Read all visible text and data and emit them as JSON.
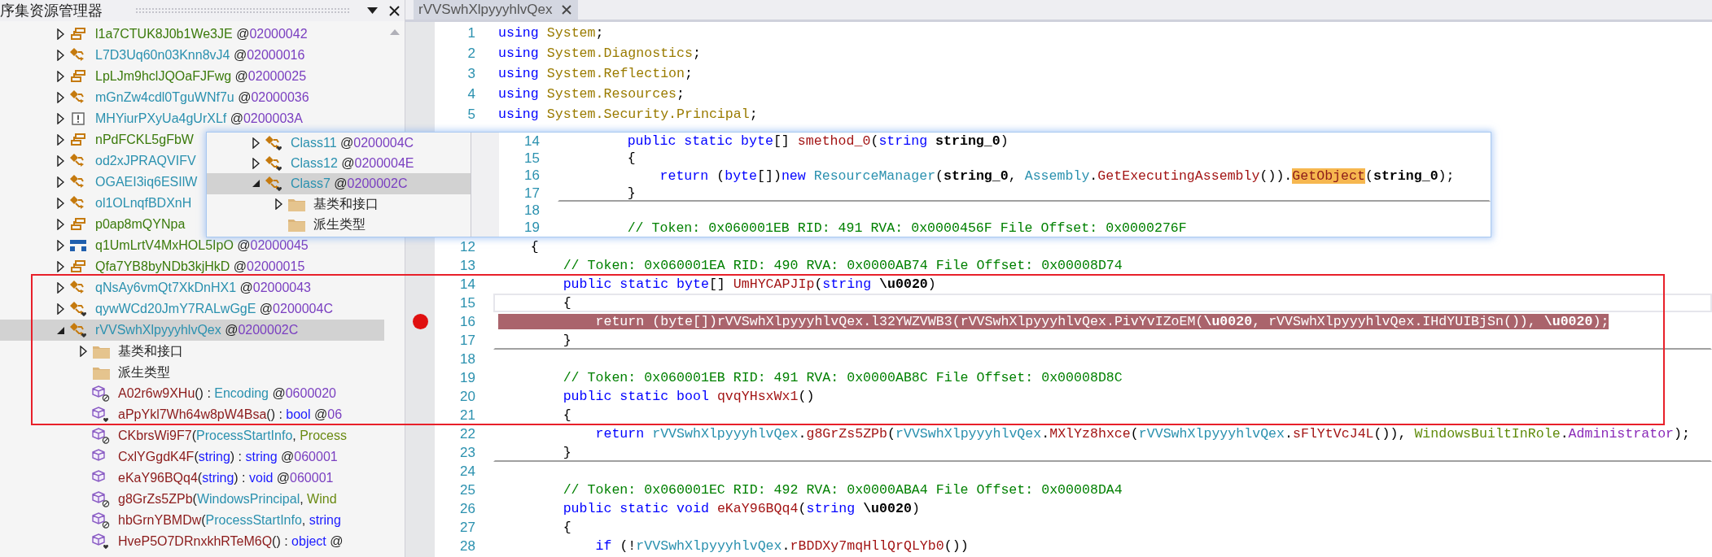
{
  "explorer": {
    "title": "序集资源管理器",
    "nodes": [
      {
        "kind": "static-class",
        "expanded": false,
        "selected": false,
        "parts": [
          {
            "text": "l1a7CTUK8J0b1We3JE",
            "kind": "sname"
          },
          {
            "text": " @",
            "kind": "punct"
          },
          {
            "text": "02000042",
            "kind": "token"
          }
        ]
      },
      {
        "kind": "class",
        "expanded": false,
        "selected": false,
        "parts": [
          {
            "text": "L7D3Uq60n03Knn8vJ4",
            "kind": "cname"
          },
          {
            "text": " @",
            "kind": "punct"
          },
          {
            "text": "02000016",
            "kind": "token"
          }
        ]
      },
      {
        "kind": "static-class",
        "expanded": false,
        "selected": false,
        "parts": [
          {
            "text": "LpLJm9hclJQOaFJFwg",
            "kind": "sname"
          },
          {
            "text": " @",
            "kind": "punct"
          },
          {
            "text": "02000025",
            "kind": "token"
          }
        ]
      },
      {
        "kind": "class",
        "expanded": false,
        "selected": false,
        "parts": [
          {
            "text": "mGnZw4cdl0TguWNf7u",
            "kind": "cname"
          },
          {
            "text": " @",
            "kind": "punct"
          },
          {
            "text": "02000036",
            "kind": "token"
          }
        ]
      },
      {
        "kind": "exception",
        "expanded": false,
        "selected": false,
        "parts": [
          {
            "text": "MHYiurPXyUa4gUrXLf",
            "kind": "cname"
          },
          {
            "text": " @",
            "kind": "punct"
          },
          {
            "text": "0200003A",
            "kind": "token"
          }
        ]
      },
      {
        "kind": "static-class",
        "expanded": false,
        "selected": false,
        "parts": [
          {
            "text": "nPdFCKL5gFbW",
            "kind": "sname"
          }
        ]
      },
      {
        "kind": "class",
        "expanded": false,
        "selected": false,
        "parts": [
          {
            "text": "od2xJPRAQVIFV",
            "kind": "cname"
          }
        ]
      },
      {
        "kind": "class",
        "expanded": false,
        "selected": false,
        "parts": [
          {
            "text": "OGAEI3iq6ESIlW",
            "kind": "cname"
          }
        ]
      },
      {
        "kind": "class",
        "expanded": false,
        "selected": false,
        "parts": [
          {
            "text": "ol1OLnqfBDXnH",
            "kind": "cname"
          }
        ]
      },
      {
        "kind": "static-class",
        "expanded": false,
        "selected": false,
        "parts": [
          {
            "text": "p0ap8mQYNpa",
            "kind": "sname"
          }
        ]
      },
      {
        "kind": "struct",
        "expanded": false,
        "selected": false,
        "parts": [
          {
            "text": "q1UmLrtV4MxHOL5IpO",
            "kind": "sname"
          },
          {
            "text": " @",
            "kind": "punct"
          },
          {
            "text": "02000045",
            "kind": "token"
          }
        ]
      },
      {
        "kind": "static-class",
        "expanded": false,
        "selected": false,
        "parts": [
          {
            "text": "Qfa7YB8byNDb3kjHkD",
            "kind": "sname"
          },
          {
            "text": " @",
            "kind": "punct"
          },
          {
            "text": "02000015",
            "kind": "token"
          }
        ]
      },
      {
        "kind": "class",
        "expanded": false,
        "selected": false,
        "parts": [
          {
            "text": "qNsAy6vmQt7XkDnHX1",
            "kind": "cname"
          },
          {
            "text": " @",
            "kind": "punct"
          },
          {
            "text": "02000043",
            "kind": "token"
          }
        ]
      },
      {
        "kind": "internal-class",
        "expanded": false,
        "selected": false,
        "parts": [
          {
            "text": "qywWCd20JmY7RALwGgE",
            "kind": "cname"
          },
          {
            "text": " @",
            "kind": "punct"
          },
          {
            "text": "0200004C",
            "kind": "token"
          }
        ]
      },
      {
        "kind": "internal-class",
        "expanded": true,
        "selected": true,
        "parts": [
          {
            "text": "rVVSwhXlpyyyhlvQex",
            "kind": "cname"
          },
          {
            "text": " @",
            "kind": "punct"
          },
          {
            "text": "0200002C",
            "kind": "token"
          }
        ],
        "children": [
          {
            "kind": "folder",
            "expanded": false,
            "selected": false,
            "parts": [
              {
                "text": "基类和接口",
                "kind": "text"
              }
            ]
          },
          {
            "kind": "folder",
            "selected": false,
            "parts": [
              {
                "text": "派生类型",
                "kind": "text"
              }
            ]
          },
          {
            "kind": "private-method",
            "selected": false,
            "parts": [
              {
                "text": "A02r6w9XHu",
                "kind": "mname"
              },
              {
                "text": "() : ",
                "kind": "punct"
              },
              {
                "text": "Encoding",
                "kind": "type"
              },
              {
                "text": " @",
                "kind": "punct"
              },
              {
                "text": "0600020",
                "kind": "token"
              }
            ]
          },
          {
            "kind": "internal-method",
            "selected": false,
            "parts": [
              {
                "text": "aPpYkl7Wh64w8pW4Bsa",
                "kind": "mname"
              },
              {
                "text": "() : ",
                "kind": "punct"
              },
              {
                "text": "bool",
                "kind": "kw"
              },
              {
                "text": " @",
                "kind": "punct"
              },
              {
                "text": "06",
                "kind": "token"
              }
            ]
          },
          {
            "kind": "private-method",
            "selected": false,
            "parts": [
              {
                "text": "CKbrsWi9F7",
                "kind": "mname"
              },
              {
                "text": "(",
                "kind": "punct"
              },
              {
                "text": "ProcessStartInfo",
                "kind": "type"
              },
              {
                "text": ", ",
                "kind": "punct"
              },
              {
                "text": "Process",
                "kind": "enum"
              }
            ]
          },
          {
            "kind": "method",
            "selected": false,
            "parts": [
              {
                "text": "CxlYGgdK4F",
                "kind": "mname"
              },
              {
                "text": "(",
                "kind": "punct"
              },
              {
                "text": "string",
                "kind": "kw"
              },
              {
                "text": ") : ",
                "kind": "punct"
              },
              {
                "text": "string",
                "kind": "kw"
              },
              {
                "text": " @",
                "kind": "punct"
              },
              {
                "text": "060001",
                "kind": "token"
              }
            ]
          },
          {
            "kind": "method",
            "selected": false,
            "parts": [
              {
                "text": "eKaY96BQq4",
                "kind": "mname"
              },
              {
                "text": "(",
                "kind": "punct"
              },
              {
                "text": "string",
                "kind": "kw"
              },
              {
                "text": ") : ",
                "kind": "punct"
              },
              {
                "text": "void",
                "kind": "kw"
              },
              {
                "text": " @",
                "kind": "punct"
              },
              {
                "text": "060001",
                "kind": "token"
              }
            ]
          },
          {
            "kind": "private-method",
            "selected": false,
            "parts": [
              {
                "text": "g8GrZs5ZPb",
                "kind": "mname"
              },
              {
                "text": "(",
                "kind": "punct"
              },
              {
                "text": "WindowsPrincipal",
                "kind": "type"
              },
              {
                "text": ", ",
                "kind": "punct"
              },
              {
                "text": "Wind",
                "kind": "enum"
              }
            ]
          },
          {
            "kind": "private-method",
            "selected": false,
            "parts": [
              {
                "text": "hbGrnYBMDw",
                "kind": "mname"
              },
              {
                "text": "(",
                "kind": "punct"
              },
              {
                "text": "ProcessStartInfo",
                "kind": "type"
              },
              {
                "text": ", ",
                "kind": "punct"
              },
              {
                "text": "string",
                "kind": "kw"
              }
            ]
          },
          {
            "kind": "internal-method",
            "selected": false,
            "parts": [
              {
                "text": "HveP5O7DRnxkhRTeM6Q",
                "kind": "mname"
              },
              {
                "text": "() : ",
                "kind": "punct"
              },
              {
                "text": "object",
                "kind": "kw"
              },
              {
                "text": " @",
                "kind": "punct"
              }
            ]
          }
        ]
      }
    ]
  },
  "editor": {
    "tabs": [
      {
        "label": "rVVSwhXlpyyyhlvQex",
        "selected": true
      }
    ],
    "lines_top": [
      {
        "num": "1",
        "breakpoint": false,
        "current": false,
        "segs": [
          {
            "text": "using",
            "kind": "kw"
          },
          {
            "text": " System",
            "kind": "ns"
          },
          {
            "text": ";",
            "kind": "plain"
          }
        ]
      },
      {
        "num": "2",
        "breakpoint": false,
        "current": false,
        "segs": [
          {
            "text": "using",
            "kind": "kw"
          },
          {
            "text": " System.Diagnostics",
            "kind": "ns"
          },
          {
            "text": ";",
            "kind": "plain"
          }
        ]
      },
      {
        "num": "3",
        "breakpoint": false,
        "current": false,
        "segs": [
          {
            "text": "using",
            "kind": "kw"
          },
          {
            "text": " System.Reflection",
            "kind": "ns"
          },
          {
            "text": ";",
            "kind": "plain"
          }
        ]
      },
      {
        "num": "4",
        "breakpoint": false,
        "current": false,
        "segs": [
          {
            "text": "using",
            "kind": "kw"
          },
          {
            "text": " System.Resources",
            "kind": "ns"
          },
          {
            "text": ";",
            "kind": "plain"
          }
        ]
      },
      {
        "num": "5",
        "breakpoint": false,
        "current": false,
        "segs": [
          {
            "text": "using",
            "kind": "kw"
          },
          {
            "text": " System.Security.Principal",
            "kind": "ns"
          },
          {
            "text": ";",
            "kind": "plain"
          }
        ]
      }
    ],
    "lines": [
      {
        "num": "12",
        "breakpoint": false,
        "current": false,
        "segs": [
          {
            "text": "    {",
            "kind": "plain"
          }
        ]
      },
      {
        "num": "13",
        "breakpoint": false,
        "current": false,
        "segs": [
          {
            "text": "        // Token: 0x060001EA RID: 490 RVA: 0x0000AB74 File Offset: 0x00008D74",
            "kind": "comment"
          }
        ]
      },
      {
        "num": "14",
        "breakpoint": false,
        "current": false,
        "segs": [
          {
            "text": "        public static byte",
            "kind": "kw"
          },
          {
            "text": "[] ",
            "kind": "plain"
          },
          {
            "text": "UmHYCAPJIp",
            "kind": "method"
          },
          {
            "text": "(",
            "kind": "plain"
          },
          {
            "text": "string",
            "kind": "kw"
          },
          {
            "text": " \\u0020",
            "kind": "param"
          },
          {
            "text": ")",
            "kind": "plain"
          }
        ]
      },
      {
        "num": "15",
        "breakpoint": false,
        "current": true,
        "segs": [
          {
            "text": "        {",
            "kind": "plain"
          }
        ]
      },
      {
        "num": "16",
        "breakpoint": true,
        "current": false,
        "segs": [
          {
            "text": "            return",
            "kind": "kw"
          },
          {
            "text": " (",
            "kind": "plain"
          },
          {
            "text": "byte",
            "kind": "kw"
          },
          {
            "text": "[])",
            "kind": "plain"
          },
          {
            "text": "rVVSwhXlpyyyhlvQex",
            "kind": "type"
          },
          {
            "text": ".",
            "kind": "plain"
          },
          {
            "text": "l32YWZVWB3",
            "kind": "method"
          },
          {
            "text": "(",
            "kind": "plain"
          },
          {
            "text": "rVVSwhXlpyyyhlvQex",
            "kind": "type"
          },
          {
            "text": ".",
            "kind": "plain"
          },
          {
            "text": "PivYvIZoEM",
            "kind": "method"
          },
          {
            "text": "(",
            "kind": "plain"
          },
          {
            "text": "\\u0020",
            "kind": "param"
          },
          {
            "text": ", ",
            "kind": "plain"
          },
          {
            "text": "rVVSwhXlpyyyhlvQex",
            "kind": "type"
          },
          {
            "text": ".",
            "kind": "plain"
          },
          {
            "text": "IHdYUIBjSn",
            "kind": "method"
          },
          {
            "text": "()), ",
            "kind": "plain"
          },
          {
            "text": "\\u0020",
            "kind": "param"
          },
          {
            "text": ");",
            "kind": "plain"
          }
        ]
      },
      {
        "num": "17",
        "breakpoint": false,
        "current": false,
        "separator": true,
        "segs": [
          {
            "text": "        }",
            "kind": "plain"
          }
        ]
      },
      {
        "num": "18",
        "breakpoint": false,
        "current": false
      },
      {
        "num": "19",
        "breakpoint": false,
        "current": false,
        "segs": [
          {
            "text": "        // Token: 0x060001EB RID: 491 RVA: 0x0000AB8C File Offset: 0x00008D8C",
            "kind": "comment"
          }
        ]
      },
      {
        "num": "20",
        "breakpoint": false,
        "current": false,
        "segs": [
          {
            "text": "        public static bool ",
            "kind": "kw"
          },
          {
            "text": "qvqYHsxWx1",
            "kind": "method"
          },
          {
            "text": "()",
            "kind": "plain"
          }
        ]
      },
      {
        "num": "21",
        "breakpoint": false,
        "current": false,
        "segs": [
          {
            "text": "        {",
            "kind": "plain"
          }
        ]
      },
      {
        "num": "22",
        "breakpoint": false,
        "current": false,
        "segs": [
          {
            "text": "            return ",
            "kind": "kw"
          },
          {
            "text": "rVVSwhXlpyyyhlvQex",
            "kind": "type"
          },
          {
            "text": ".",
            "kind": "plain"
          },
          {
            "text": "g8GrZs5ZPb",
            "kind": "method"
          },
          {
            "text": "(",
            "kind": "plain"
          },
          {
            "text": "rVVSwhXlpyyyhlvQex",
            "kind": "type"
          },
          {
            "text": ".",
            "kind": "plain"
          },
          {
            "text": "MXlYz8hxce",
            "kind": "method"
          },
          {
            "text": "(",
            "kind": "plain"
          },
          {
            "text": "rVVSwhXlpyyyhlvQex",
            "kind": "type"
          },
          {
            "text": ".",
            "kind": "plain"
          },
          {
            "text": "sFlYtVcJ4L",
            "kind": "method"
          },
          {
            "text": "()), ",
            "kind": "plain"
          },
          {
            "text": "WindowsBuiltInRole",
            "kind": "enum"
          },
          {
            "text": ".",
            "kind": "plain"
          },
          {
            "text": "Administrator",
            "kind": "enumval"
          },
          {
            "text": ");",
            "kind": "plain"
          }
        ]
      },
      {
        "num": "23",
        "breakpoint": false,
        "current": false,
        "separator": true,
        "segs": [
          {
            "text": "        }",
            "kind": "plain"
          }
        ]
      },
      {
        "num": "24",
        "breakpoint": false,
        "current": false
      },
      {
        "num": "25",
        "breakpoint": false,
        "current": false,
        "segs": [
          {
            "text": "        // Token: 0x060001EC RID: 492 RVA: 0x0000ABA4 File Offset: 0x00008DA4",
            "kind": "comment"
          }
        ]
      },
      {
        "num": "26",
        "breakpoint": false,
        "current": false,
        "segs": [
          {
            "text": "        public static void ",
            "kind": "kw"
          },
          {
            "text": "eKaY96BQq4",
            "kind": "method"
          },
          {
            "text": "(",
            "kind": "plain"
          },
          {
            "text": "string",
            "kind": "kw"
          },
          {
            "text": " \\u0020",
            "kind": "param"
          },
          {
            "text": ")",
            "kind": "plain"
          }
        ]
      },
      {
        "num": "27",
        "breakpoint": false,
        "current": false,
        "segs": [
          {
            "text": "        {",
            "kind": "plain"
          }
        ]
      },
      {
        "num": "28",
        "breakpoint": false,
        "current": false,
        "segs": [
          {
            "text": "            if",
            "kind": "kw"
          },
          {
            "text": " (!",
            "kind": "plain"
          },
          {
            "text": "rVVSwhXlpyyyhlvQex",
            "kind": "type"
          },
          {
            "text": ".",
            "kind": "plain"
          },
          {
            "text": "rBDDXy7mqHllQrQLYb0",
            "kind": "method"
          },
          {
            "text": "())",
            "kind": "plain"
          }
        ]
      }
    ]
  },
  "peek": {
    "nodes": [
      {
        "kind": "internal-class",
        "expanded": false,
        "selected": false,
        "parts": [
          {
            "text": "Class11",
            "kind": "cname"
          },
          {
            "text": " @",
            "kind": "punct"
          },
          {
            "text": "0200004C",
            "kind": "token"
          }
        ]
      },
      {
        "kind": "internal-class",
        "expanded": false,
        "selected": false,
        "parts": [
          {
            "text": "Class12",
            "kind": "cname"
          },
          {
            "text": " @",
            "kind": "punct"
          },
          {
            "text": "0200004E",
            "kind": "token"
          }
        ]
      },
      {
        "kind": "internal-class",
        "expanded": true,
        "selected": true,
        "parts": [
          {
            "text": "Class7",
            "kind": "cname"
          },
          {
            "text": " @",
            "kind": "punct"
          },
          {
            "text": "0200002C",
            "kind": "token"
          }
        ],
        "children": [
          {
            "kind": "folder",
            "expanded": false,
            "selected": false,
            "parts": [
              {
                "text": "基类和接口",
                "kind": "text"
              }
            ]
          },
          {
            "kind": "folder",
            "selected": false,
            "parts": [
              {
                "text": "派生类型",
                "kind": "text"
              }
            ]
          }
        ]
      }
    ],
    "lines": [
      {
        "num": "14",
        "breakpoint": false,
        "current": false,
        "segs": [
          {
            "text": "        public static byte",
            "kind": "kw"
          },
          {
            "text": "[] ",
            "kind": "plain"
          },
          {
            "text": "smethod_0",
            "kind": "method"
          },
          {
            "text": "(",
            "kind": "plain"
          },
          {
            "text": "string",
            "kind": "kw"
          },
          {
            "text": " string_0",
            "kind": "param"
          },
          {
            "text": ")",
            "kind": "plain"
          }
        ]
      },
      {
        "num": "15",
        "breakpoint": false,
        "current": false,
        "segs": [
          {
            "text": "        {",
            "kind": "plain"
          }
        ]
      },
      {
        "num": "16",
        "breakpoint": false,
        "current": false,
        "segs": [
          {
            "text": "            return",
            "kind": "kw"
          },
          {
            "text": " (",
            "kind": "plain"
          },
          {
            "text": "byte",
            "kind": "kw"
          },
          {
            "text": "[])",
            "kind": "plain"
          },
          {
            "text": "new ",
            "kind": "kw"
          },
          {
            "text": "ResourceManager",
            "kind": "type"
          },
          {
            "text": "(",
            "kind": "plain"
          },
          {
            "text": "string_0",
            "kind": "param"
          },
          {
            "text": ", ",
            "kind": "plain"
          },
          {
            "text": "Assembly",
            "kind": "type"
          },
          {
            "text": ".",
            "kind": "plain"
          },
          {
            "text": "GetExecutingAssembly",
            "kind": "method"
          },
          {
            "text": "()).",
            "kind": "plain"
          },
          {
            "text": "GetObject",
            "kind": "match"
          },
          {
            "text": "(",
            "kind": "plain"
          },
          {
            "text": "string_0",
            "kind": "param"
          },
          {
            "text": ");",
            "kind": "plain"
          }
        ]
      },
      {
        "num": "17",
        "breakpoint": false,
        "current": false,
        "separator": true,
        "segs": [
          {
            "text": "        }",
            "kind": "plain"
          }
        ]
      },
      {
        "num": "18",
        "breakpoint": false,
        "current": false
      },
      {
        "num": "19",
        "breakpoint": false,
        "current": false,
        "segs": [
          {
            "text": "        // Token: 0x060001EB RID: 491 RVA: 0x0000456F File Offset: 0x0000276F",
            "kind": "comment"
          }
        ]
      }
    ]
  }
}
